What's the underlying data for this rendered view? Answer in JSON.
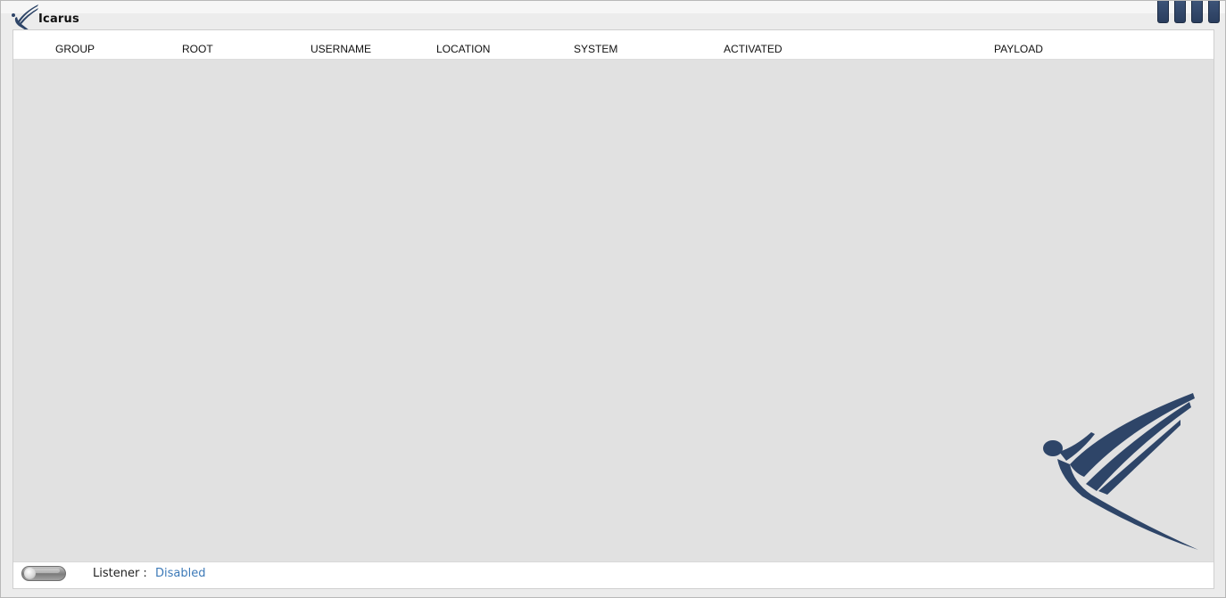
{
  "app": {
    "title": "Icarus",
    "logo_icon": "icarus-logo-icon"
  },
  "window_controls": [
    {
      "name": "window-control-1"
    },
    {
      "name": "window-control-2"
    },
    {
      "name": "window-control-3"
    },
    {
      "name": "window-control-4"
    }
  ],
  "table": {
    "columns": [
      "GROUP",
      "ROOT",
      "USERNAME",
      "LOCATION",
      "SYSTEM",
      "ACTIVATED",
      "PAYLOAD"
    ],
    "rows": []
  },
  "status": {
    "listener_label": "Listener :",
    "listener_value": "Disabled",
    "listener_enabled": false
  },
  "colors": {
    "accent": "#2e4568",
    "status_disabled": "#3d7ab8"
  }
}
